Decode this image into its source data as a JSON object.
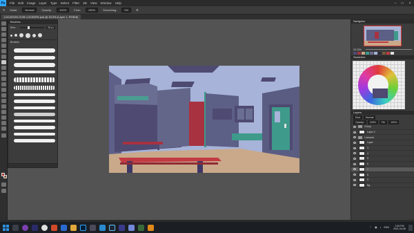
{
  "app": {
    "logo_text": "Ps",
    "menu": [
      "File",
      "Edit",
      "Image",
      "Layer",
      "Type",
      "Select",
      "Filter",
      "3D",
      "View",
      "Window",
      "Help"
    ]
  },
  "options": {
    "mode_label": "Mode:",
    "mode_value": "Normal",
    "opacity_label": "Opacity:",
    "opacity_value": "100%",
    "flow_label": "Flow:",
    "flow_value": "100%",
    "smoothing_label": "Smoothing:",
    "smoothing_value": "0%"
  },
  "document": {
    "tab_title": "LOCATION GYM LOCKERS.psd @ 33.3% (Layer 1, RGB/8)"
  },
  "brushes": {
    "title": "Brushes",
    "size_label": "Size:",
    "size_value": "65 px",
    "group_label": "Brushes"
  },
  "dock": {
    "navigator_tab": "Navigator",
    "zoom": "33.33%",
    "swatches_tab": "Swatches",
    "layers_tab": "Layers",
    "kind_label": "Kind",
    "blend_mode": "Normal",
    "opacity_label": "Opacity:",
    "opacity_value": "100%",
    "fill_label": "Fill:",
    "fill_value": "100%",
    "layers": [
      {
        "name": "Group",
        "type": "group",
        "selected": false
      },
      {
        "name": "Layer 2",
        "type": "layer",
        "selected": false
      },
      {
        "name": "Linework",
        "type": "group",
        "selected": false
      },
      {
        "name": "Layer",
        "type": "layer",
        "selected": false
      },
      {
        "name": "3",
        "type": "layer",
        "selected": false
      },
      {
        "name": "4",
        "type": "layer",
        "selected": false
      },
      {
        "name": "5",
        "type": "layer",
        "selected": false
      },
      {
        "name": "6",
        "type": "layer",
        "selected": false
      },
      {
        "name": "7",
        "type": "layer",
        "selected": true
      },
      {
        "name": "8",
        "type": "layer",
        "selected": false
      },
      {
        "name": "9",
        "type": "layer",
        "selected": false
      },
      {
        "name": "Bg",
        "type": "layer",
        "selected": false
      }
    ]
  },
  "status": {
    "zoom": "33.33%",
    "doc": "Doc: 24.0M/396.4M"
  },
  "taskbar": {
    "time": "2:26 PM",
    "date": "2021-04-06",
    "lang": "ENG"
  },
  "colors": {
    "canvas_sky": "#a7b3d8",
    "wall_dark": "#4e4f72",
    "wall_mid": "#6a6d8f",
    "floor": "#c9a98a",
    "bench_top": "#c23a43",
    "door_teal": "#3e9a8a",
    "accent_red": "#a8323f"
  }
}
